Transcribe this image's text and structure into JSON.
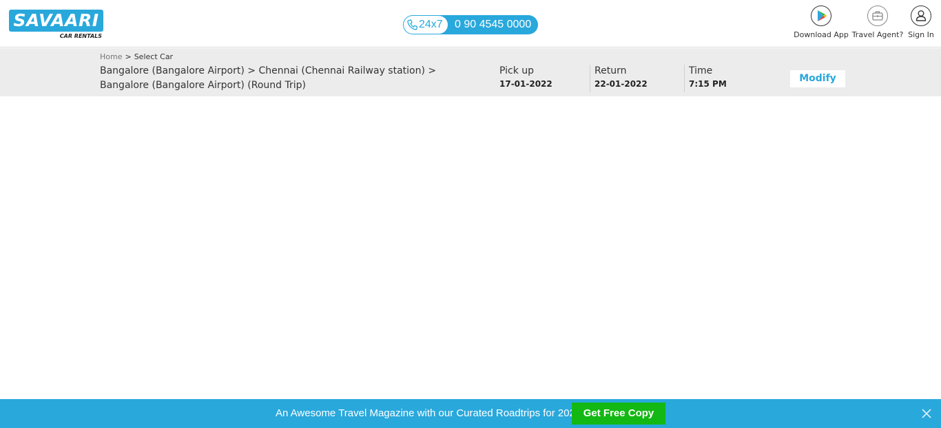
{
  "header": {
    "logo": {
      "brand": "SAVAARI",
      "tagline": "CAR RENTALS"
    },
    "phone": {
      "label_24x7": "24x7",
      "number": "0 90 4545 0000"
    },
    "actions": [
      {
        "label": "Download App",
        "icon": "google-play-icon"
      },
      {
        "label": "Travel Agent?",
        "icon": "briefcase-icon"
      },
      {
        "label": "Sign In",
        "icon": "user-icon"
      }
    ]
  },
  "breadcrumb": {
    "home": "Home",
    "separator": ">",
    "current": "Select Car"
  },
  "trip": {
    "route": "Bangalore (Bangalore Airport) > Chennai (Chennai Railway station) > Bangalore (Bangalore Airport) (Round Trip)",
    "pickup": {
      "label": "Pick up",
      "value": "17-01-2022"
    },
    "return": {
      "label": "Return",
      "value": "22-01-2022"
    },
    "time": {
      "label": "Time",
      "value": "7:15 PM"
    },
    "modify_label": "Modify"
  },
  "promo": {
    "text": "An Awesome Travel Magazine with our Curated Roadtrips for 2022",
    "button": "Get Free Copy",
    "close_icon": "close-icon"
  },
  "colors": {
    "brand": "#29a8dc",
    "promo_button": "#14b814",
    "summary_bg": "#ececec"
  }
}
